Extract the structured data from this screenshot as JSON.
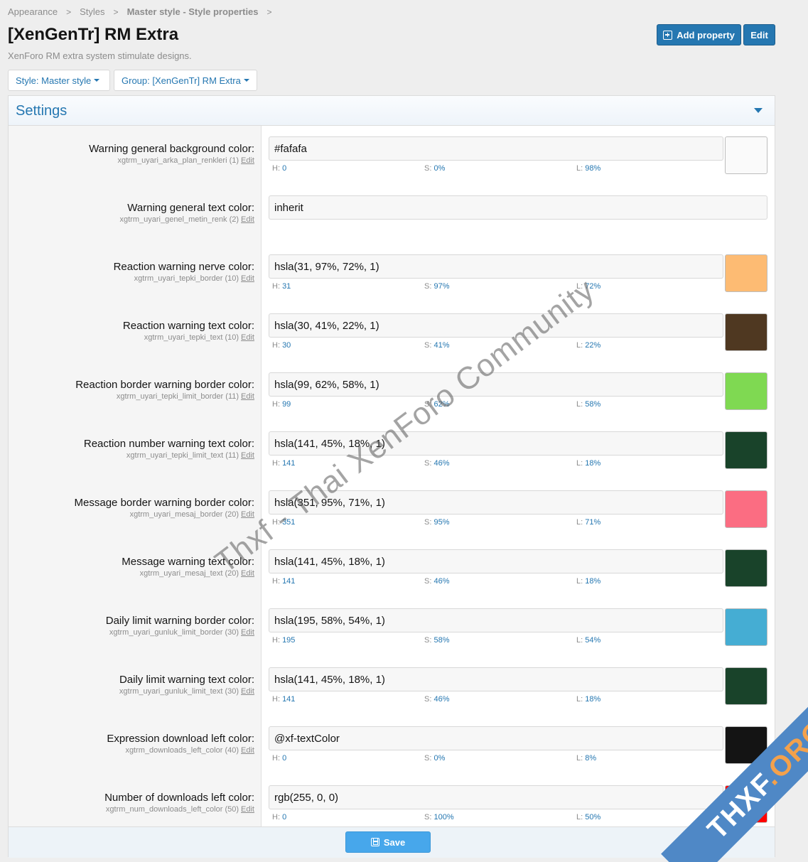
{
  "breadcrumb": {
    "items": [
      "Appearance",
      "Styles",
      "Master style - Style properties"
    ],
    "separator": ">"
  },
  "page": {
    "title": "[XenGenTr] RM Extra",
    "description": "XenForo RM extra system stimulate designs."
  },
  "header_actions": {
    "add_property": "Add property",
    "edit": "Edit"
  },
  "filters": {
    "style": "Style: Master style",
    "group": "Group: [XenGenTr] RM Extra"
  },
  "settings": {
    "title": "Settings",
    "edit_label": "Edit",
    "hsl_labels": {
      "h": "H:",
      "s": "S:",
      "l": "L:"
    },
    "rows": [
      {
        "label": "Warning general background color:",
        "hint": "xgtrm_uyari_arka_plan_renkleri (1)",
        "value": "#fafafa",
        "h": "0",
        "s": "0%",
        "l": "98%",
        "swatch": "#fafafa"
      },
      {
        "label": "Warning general text color:",
        "hint": "xgtrm_uyari_genel_metin_renk (2)",
        "value": "inherit"
      },
      {
        "label": "Reaction warning nerve color:",
        "hint": "xgtrm_uyari_tepki_border (10)",
        "value": "hsla(31, 97%, 72%, 1)",
        "h": "31",
        "s": "97%",
        "l": "72%",
        "swatch": "#fdbb73"
      },
      {
        "label": "Reaction warning text color:",
        "hint": "xgtrm_uyari_tepki_text (10)",
        "value": "hsla(30, 41%, 22%, 1)",
        "h": "30",
        "s": "41%",
        "l": "22%",
        "swatch": "#4f3821"
      },
      {
        "label": "Reaction border warning border color:",
        "hint": "xgtrm_uyari_tepki_limit_border (11)",
        "value": "hsla(99, 62%, 58%, 1)",
        "h": "99",
        "s": "62%",
        "l": "58%",
        "swatch": "#7fd952"
      },
      {
        "label": "Reaction number warning text color:",
        "hint": "xgtrm_uyari_tepki_limit_text (11)",
        "value": "hsla(141, 45%, 18%, 1)",
        "h": "141",
        "s": "46%",
        "l": "18%",
        "swatch": "#19432a"
      },
      {
        "label": "Message border warning border color:",
        "hint": "xgtrm_uyari_mesaj_border (20)",
        "value": "hsla(351, 95%, 71%, 1)",
        "h": "351",
        "s": "95%",
        "l": "71%",
        "swatch": "#fb6d82"
      },
      {
        "label": "Message warning text color:",
        "hint": "xgtrm_uyari_mesaj_text (20)",
        "value": "hsla(141, 45%, 18%, 1)",
        "h": "141",
        "s": "46%",
        "l": "18%",
        "swatch": "#19432a"
      },
      {
        "label": "Daily limit warning border color:",
        "hint": "xgtrm_uyari_gunluk_limit_border (30)",
        "value": "hsla(195, 58%, 54%, 1)",
        "h": "195",
        "s": "58%",
        "l": "54%",
        "swatch": "#45add3"
      },
      {
        "label": "Daily limit warning text color:",
        "hint": "xgtrm_uyari_gunluk_limit_text (30)",
        "value": "hsla(141, 45%, 18%, 1)",
        "h": "141",
        "s": "46%",
        "l": "18%",
        "swatch": "#19432a"
      },
      {
        "label": "Expression download left color:",
        "hint": "xgtrm_downloads_left_color (40)",
        "value": "@xf-textColor",
        "h": "0",
        "s": "0%",
        "l": "8%",
        "swatch": "#141414"
      },
      {
        "label": "Number of downloads left color:",
        "hint": "xgtrm_num_downloads_left_color (50)",
        "value": "rgb(255, 0, 0)",
        "h": "0",
        "s": "100%",
        "l": "50%",
        "swatch": "#ff0000"
      }
    ]
  },
  "footer": {
    "save": "Save"
  },
  "watermarks": {
    "diagonal": "Thxf - Thai XenForo Community",
    "corner_main": "THXF",
    "corner_suffix": ".ORG"
  },
  "colors": {
    "accent": "#2577b1",
    "save_button": "#47a7eb",
    "ribbon": "#4f88c6",
    "ribbon_suffix": "#f3a14c"
  }
}
